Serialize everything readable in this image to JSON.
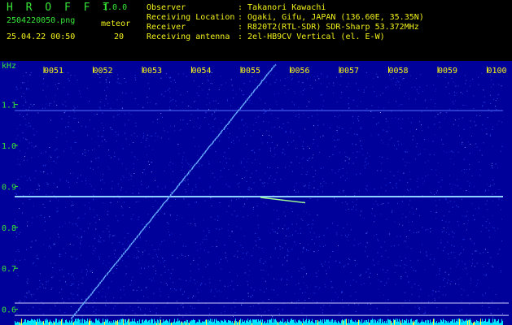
{
  "app": {
    "name": "H R O F F T",
    "version": "1.0.0",
    "filename": "2504220050.png",
    "datetime": "25.04.22 00:50",
    "meteor_label": "meteor",
    "meteor_count": "20"
  },
  "info": [
    {
      "label": "Observer",
      "value": ": Takanori Kawachi"
    },
    {
      "label": "Receiving Location",
      "value": ": Ogaki, Gifu, JAPAN (136.60E, 35.35N)"
    },
    {
      "label": "Receiver",
      "value": ": R820T2(RTL-SDR) SDR-Sharp 53.372MHz"
    },
    {
      "label": "Receiving antenna",
      "value": ": 2el-HB9CV Vertical (el. E-W)"
    }
  ],
  "axes": {
    "y_unit": "kHz",
    "y_ticks": [
      "1.1",
      "1.0",
      "0.9",
      "0.8",
      "0.7",
      "0.6"
    ],
    "y_tick_values": [
      1.1,
      1.0,
      0.9,
      0.8,
      0.7,
      0.6
    ],
    "x_ticks": [
      "0051",
      "0052",
      "0053",
      "0054",
      "0055",
      "0056",
      "0057",
      "0058",
      "0059",
      "0100"
    ]
  },
  "colors": {
    "background": "#00009a",
    "noise": "#3355ff",
    "trace": "#66aaff",
    "carrier": "#8fd0ff",
    "text_green": "#37e637",
    "text_yellow": "#f2f21a",
    "bars": "#00e5ff"
  }
}
